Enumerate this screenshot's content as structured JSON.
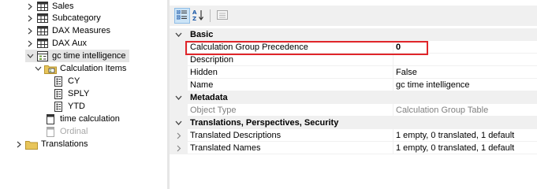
{
  "tree": {
    "items": [
      {
        "label": "Sales",
        "icon": "table-icon",
        "expander": "collapsed"
      },
      {
        "label": "Subcategory",
        "icon": "table-icon",
        "expander": "collapsed"
      },
      {
        "label": "DAX Measures",
        "icon": "table-icon",
        "expander": "collapsed"
      },
      {
        "label": "DAX Aux",
        "icon": "table-icon",
        "expander": "collapsed"
      },
      {
        "label": "gc time intelligence",
        "icon": "calculation-group-icon",
        "expander": "expanded"
      },
      {
        "label": "Calculation Items",
        "icon": "folder-calc-icon",
        "expander": "expanded"
      },
      {
        "label": "CY",
        "icon": "calculation-item-icon"
      },
      {
        "label": "SPLY",
        "icon": "calculation-item-icon"
      },
      {
        "label": "YTD",
        "icon": "calculation-item-icon"
      },
      {
        "label": "time calculation",
        "icon": "column-icon"
      },
      {
        "label": "Ordinal",
        "icon": "column-icon-dim"
      },
      {
        "label": "Translations",
        "icon": "folder-icon",
        "expander": "collapsed"
      }
    ]
  },
  "toolbar": {
    "categorized_tooltip": "Categorized",
    "alphabetical_tooltip": "Alphabetical",
    "property_pages_tooltip": "Property Pages"
  },
  "properties": {
    "basic": {
      "label": "Basic",
      "rows": [
        {
          "name": "Calculation Group Precedence",
          "value": "0"
        },
        {
          "name": "Description",
          "value": ""
        },
        {
          "name": "Hidden",
          "value": "False"
        },
        {
          "name": "Name",
          "value": "gc time intelligence"
        }
      ]
    },
    "metadata": {
      "label": "Metadata",
      "rows": [
        {
          "name": "Object Type",
          "value": "Calculation Group Table"
        }
      ]
    },
    "translations": {
      "label": "Translations, Perspectives, Security",
      "rows": [
        {
          "name": "Translated Descriptions",
          "value": "1 empty, 0 translated, 1 default"
        },
        {
          "name": "Translated Names",
          "value": "1 empty, 0 translated, 1 default"
        }
      ]
    }
  },
  "colors": {
    "highlight_border": "#e0252a",
    "selected_row": "#e5e5e5",
    "category_bg": "#f0f0f0",
    "folder_yellow": "#e8c55a",
    "calc_green": "#6e9f3c"
  }
}
